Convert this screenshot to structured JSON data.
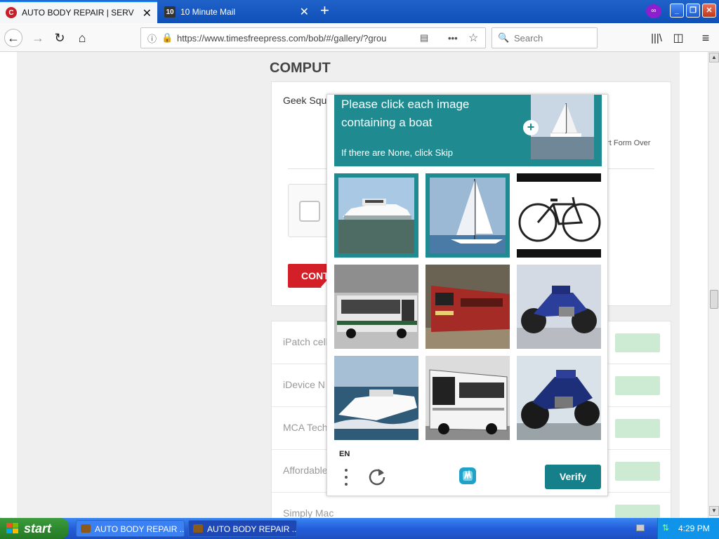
{
  "browser": {
    "tabs": [
      {
        "title": "AUTO BODY REPAIR | SERVICES",
        "favicon": "C",
        "active": true
      },
      {
        "title": "10 Minute Mail",
        "favicon": "10",
        "active": false
      }
    ],
    "url": "https://www.timesfreepress.com/bob/#/gallery/?grou",
    "search_placeholder": "Search"
  },
  "page": {
    "heading": "COMPUT",
    "card_title": "Geek Squ",
    "start_over": "art Form Over",
    "continue_label": "CONT",
    "list_items": [
      "iPatch cell",
      "iDevice N",
      "MCA Tech",
      "Affordable Computers",
      "Simply Mac"
    ]
  },
  "captcha": {
    "prompt_line1": "Please click each image",
    "prompt_line2": "containing a boat",
    "prompt_sub": "If there are None, click Skip",
    "language": "EN",
    "verify_label": "Verify",
    "accent_color": "#1f8a90",
    "tiles": [
      {
        "content": "yacht",
        "selected": true
      },
      {
        "content": "sailboat",
        "selected": true
      },
      {
        "content": "bicycle",
        "selected": false
      },
      {
        "content": "bus",
        "selected": false
      },
      {
        "content": "train",
        "selected": false
      },
      {
        "content": "motorcycle",
        "selected": false
      },
      {
        "content": "speedboat",
        "selected": false
      },
      {
        "content": "bus",
        "selected": false
      },
      {
        "content": "motorcycle",
        "selected": false
      }
    ]
  },
  "taskbar": {
    "start_label": "start",
    "items": [
      "AUTO BODY REPAIR ...",
      "AUTO BODY REPAIR ..."
    ],
    "clock": "4:29 PM"
  }
}
